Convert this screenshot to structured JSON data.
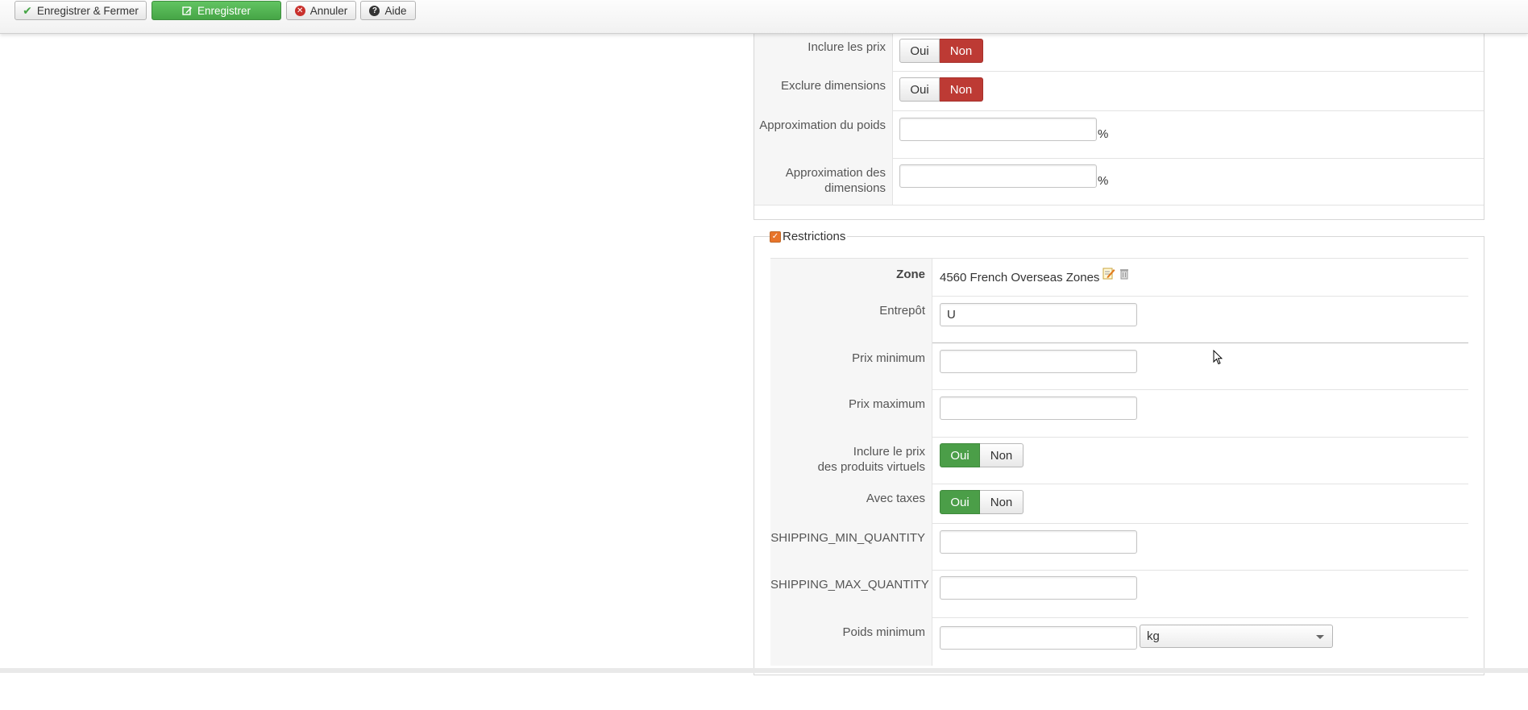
{
  "toolbar": {
    "save_close_label": "Enregistrer & Fermer",
    "save_label": "Enregistrer",
    "cancel_label": "Annuler",
    "help_label": "Aide"
  },
  "options": {
    "include_prices": {
      "label": "Inclure les prix",
      "yes": "Oui",
      "no": "Non",
      "selected": "Non"
    },
    "exclude_dimensions": {
      "label": "Exclure dimensions",
      "yes": "Oui",
      "no": "Non",
      "selected": "Non"
    },
    "weight_approx": {
      "label": "Approximation du poids",
      "value": "",
      "unit": "%"
    },
    "dimensions_approx": {
      "label_line1": "Approximation des",
      "label_line2": "dimensions",
      "value": "",
      "unit": "%"
    }
  },
  "restrictions": {
    "legend": "Restrictions",
    "checked": true,
    "zone": {
      "label": "Zone",
      "value": "4560 French Overseas Zones"
    },
    "warehouse": {
      "label": "Entrepôt",
      "value": "U"
    },
    "min_price": {
      "label": "Prix minimum",
      "value": ""
    },
    "max_price": {
      "label": "Prix maximum",
      "value": ""
    },
    "virtual_products": {
      "label_line1": "Inclure le prix",
      "label_line2": "des produits virtuels",
      "yes": "Oui",
      "no": "Non",
      "selected": "Oui"
    },
    "with_taxes": {
      "label": "Avec taxes",
      "yes": "Oui",
      "no": "Non",
      "selected": "Oui"
    },
    "min_quantity": {
      "label": "SHIPPING_MIN_QUANTITY",
      "value": ""
    },
    "max_quantity": {
      "label": "SHIPPING_MAX_QUANTITY",
      "value": ""
    },
    "min_weight": {
      "label": "Poids minimum",
      "value": "",
      "unit": "kg"
    }
  },
  "colors": {
    "red": "#bd3a34",
    "green": "#4b9e48",
    "toolbar_green": "#46a546",
    "checkbox": "#e8742a"
  }
}
